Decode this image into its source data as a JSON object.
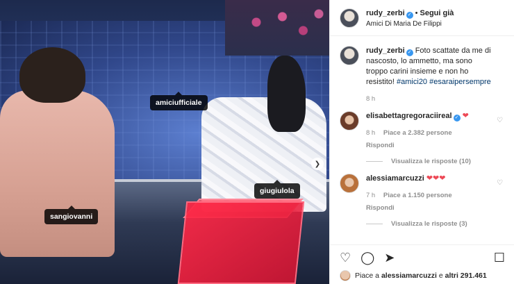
{
  "post": {
    "username": "rudy_zerbi",
    "follow_label": "Segui già",
    "location": "Amici Di Maria De Filippi",
    "caption_text": "Foto scattate da me di nascosto, lo ammetto, ma sono troppo carini insieme e non ho resistito!",
    "caption_hashtags": "#amici20 #esaraipersempre",
    "caption_time": "8 h"
  },
  "photo_tags": {
    "tag1": "amiciufficiale",
    "tag2": "sangiovanni",
    "tag3": "giugiulola"
  },
  "comments": [
    {
      "username": "elisabettagregoraciireal",
      "hearts": "❤",
      "time": "8 h",
      "likes": "Piace a 2.382 persone",
      "reply": "Rispondi",
      "view_replies": "Visualizza le risposte (10)"
    },
    {
      "username": "alessiamarcuzzi",
      "hearts": "❤❤❤",
      "time": "7 h",
      "likes": "Piace a 1.150 persone",
      "reply": "Rispondi",
      "view_replies": "Visualizza le risposte (3)"
    }
  ],
  "footer": {
    "likes_prefix": "Piace a",
    "likes_user": "alessiamarcuzzi",
    "likes_joiner": "e",
    "likes_others": "altri 291.461"
  },
  "icons": {
    "like": "heart-outline-icon",
    "comment": "comment-icon",
    "share": "share-icon",
    "save": "bookmark-icon",
    "verified": "verified-badge-icon",
    "carousel_next": "chevron-right-icon"
  },
  "colors": {
    "verified": "#3897f0",
    "heart": "#ed4956",
    "hashtag": "#00376b",
    "meta": "#8e8e8e"
  }
}
